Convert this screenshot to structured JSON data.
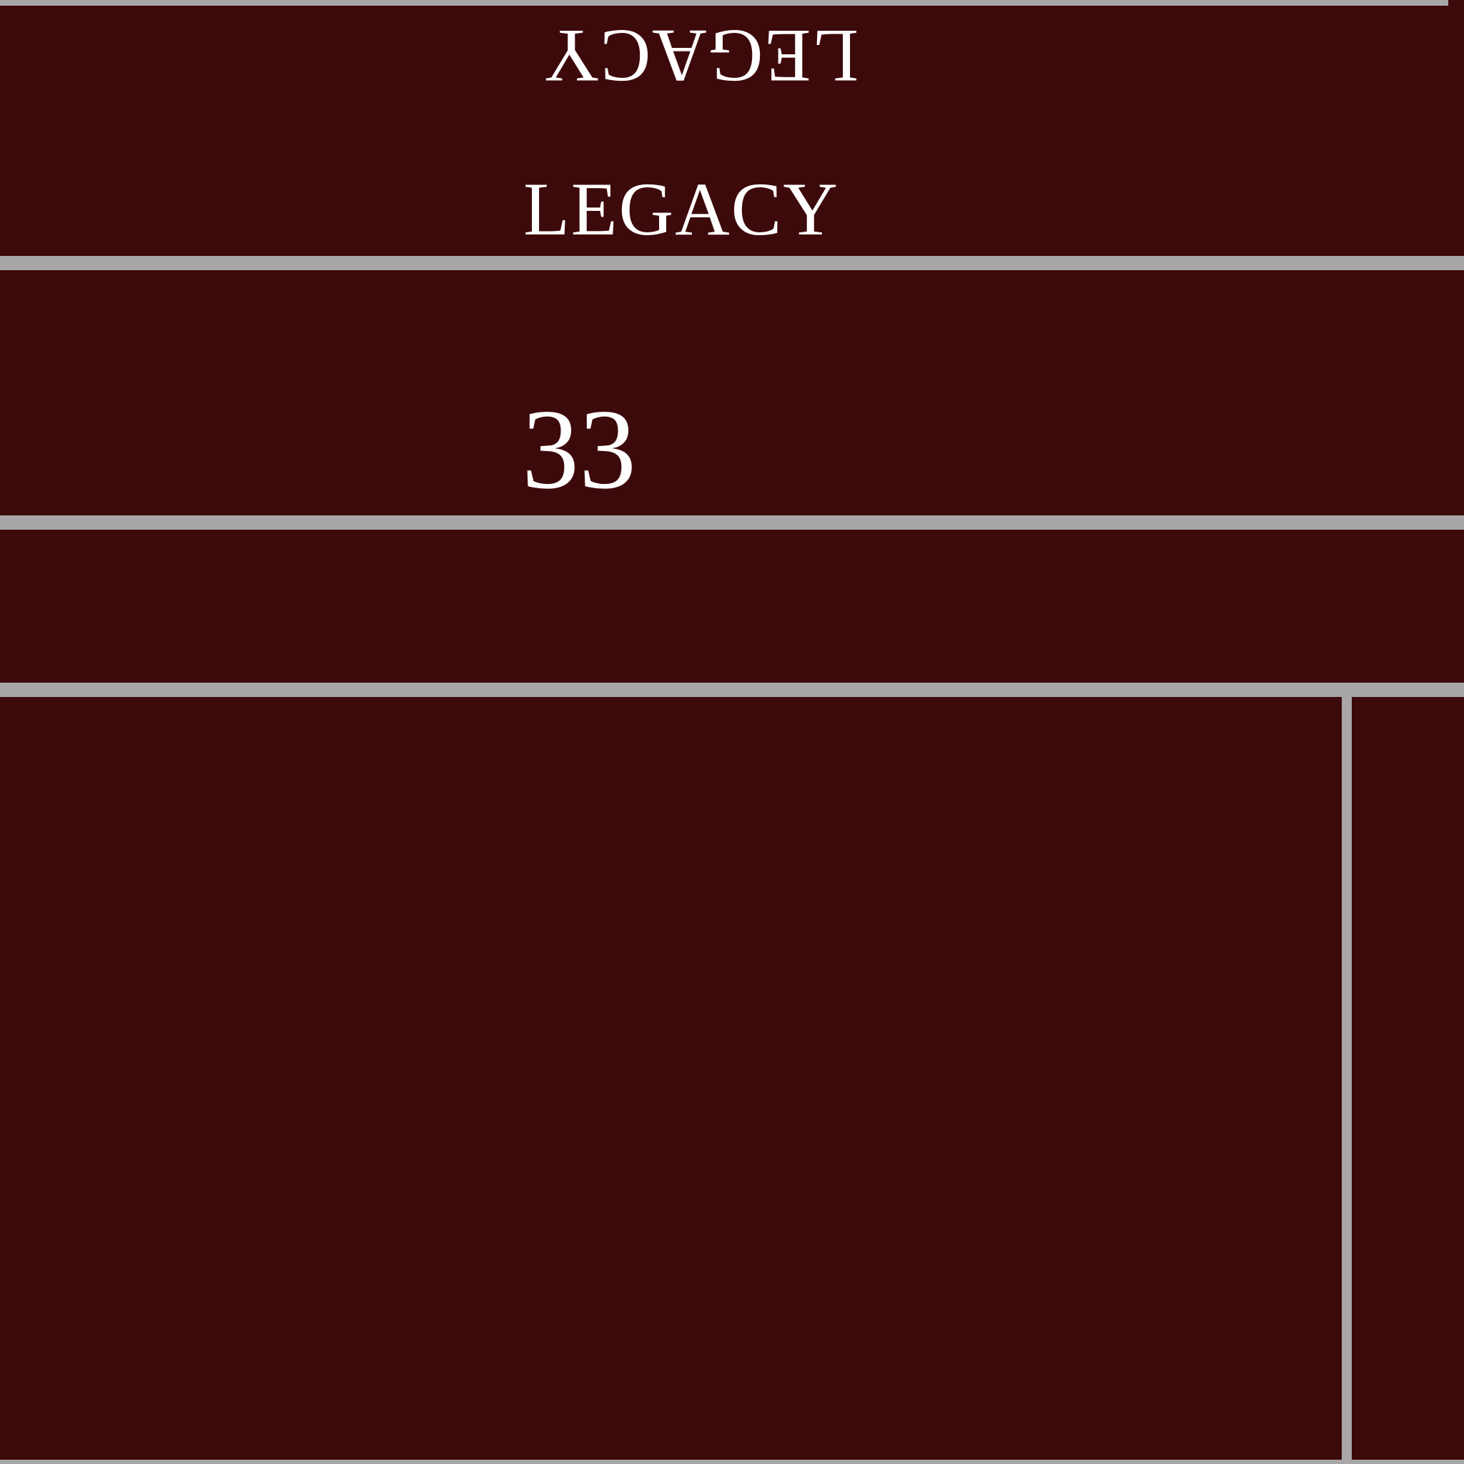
{
  "card": {
    "title_flipped": "LEGACY",
    "title": "LEGACY",
    "counter": "33"
  },
  "colors": {
    "panel": "#3d0a0b",
    "border": "#a8a6a6",
    "text": "#ffffff"
  }
}
